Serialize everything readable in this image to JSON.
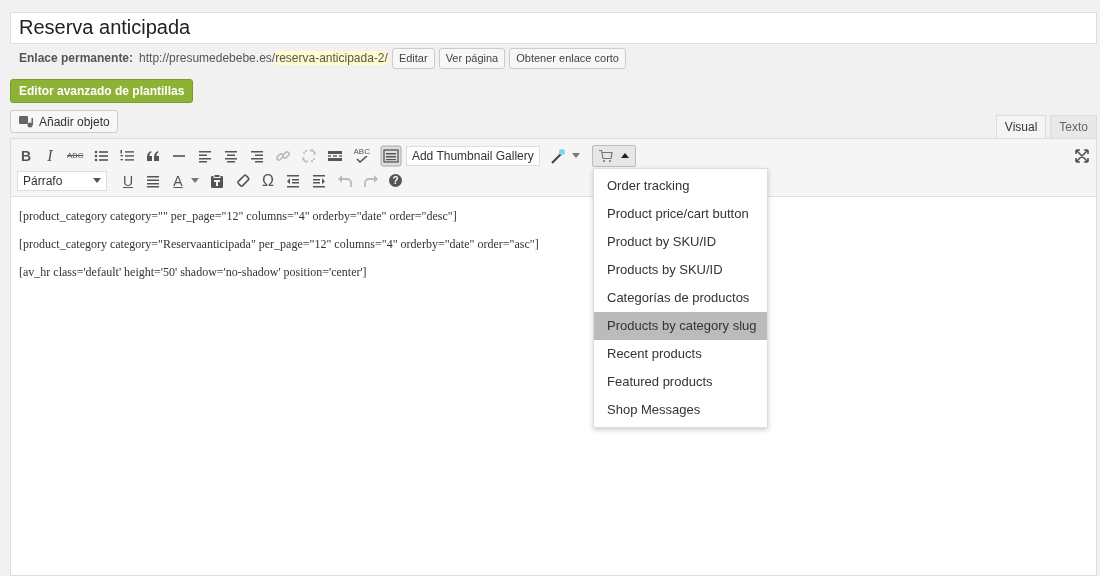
{
  "title_field": {
    "value": "Reserva anticipada"
  },
  "permalink": {
    "label": "Enlace permanente:",
    "url_base": "http://presumedebebe.es/",
    "slug": "reserva-anticipada-2/",
    "buttons": [
      "Editar",
      "Ver página",
      "Obtener enlace corto"
    ]
  },
  "template_editor_button": "Editor avanzado de plantillas",
  "add_media_button": "Añadir objeto",
  "editor_tabs": [
    {
      "label": "Visual",
      "selected": true
    },
    {
      "label": "Texto",
      "selected": false
    }
  ],
  "toolbar": {
    "bold": "B",
    "italic": "I",
    "strike": "ABC",
    "spell": "ABC",
    "gallery_select": "Add Thumbnail Gallery",
    "format_select": "Párrafo",
    "underline": "U",
    "text_color": "A",
    "special_char": "Ω",
    "help": "?"
  },
  "content": [
    "[product_category category=\"\" per_page=\"12\" columns=\"4\" orderby=\"date\" order=\"desc\"]",
    "[product_category category=\"Reservaanticipada\" per_page=\"12\" columns=\"4\" orderby=\"date\" order=\"asc\"]",
    "[av_hr class='default' height='50' shadow='no-shadow' position='center']"
  ],
  "shop_menu": [
    {
      "label": "Order tracking",
      "selected": false
    },
    {
      "label": "Product price/cart button",
      "selected": false
    },
    {
      "label": "Product by SKU/ID",
      "selected": false
    },
    {
      "label": "Products by SKU/ID",
      "selected": false
    },
    {
      "label": "Categorías de productos",
      "selected": false
    },
    {
      "label": "Products by category slug",
      "selected": true
    },
    {
      "label": "Recent products",
      "selected": false
    },
    {
      "label": "Featured products",
      "selected": false
    },
    {
      "label": "Shop Messages",
      "selected": false
    }
  ]
}
